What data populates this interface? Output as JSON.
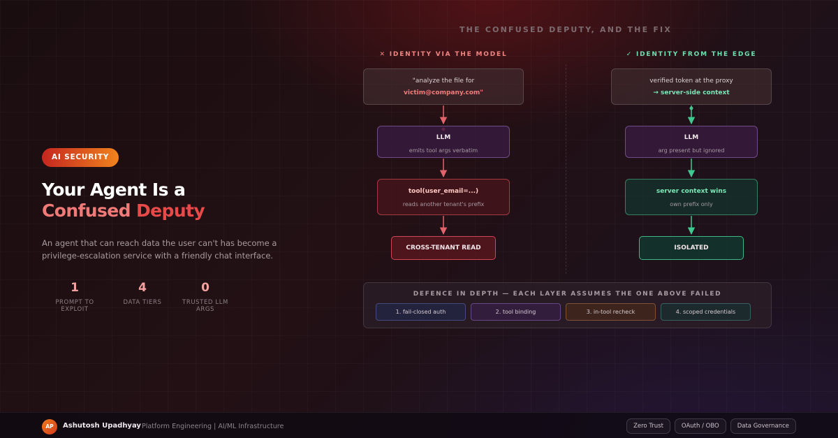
{
  "left": {
    "badge": "AI SECURITY",
    "headline_line1": "Your Agent Is a",
    "headline_line2a": "Confused ",
    "headline_line2b": "Deputy",
    "description": "An agent that can reach data the user can't has become a privilege-escalation service with a friendly chat interface.",
    "stats": [
      {
        "value": "1",
        "label": "PROMPT TO EXPLOIT"
      },
      {
        "value": "4",
        "label": "DATA TIERS"
      },
      {
        "value": "0",
        "label": "TRUSTED LLM ARGS"
      }
    ]
  },
  "diagram": {
    "title": "THE CONFUSED DEPUTY, AND THE FIX",
    "left_column": {
      "title": "✕ IDENTITY VIA THE MODEL",
      "quote_line1": "\"analyze the file for",
      "quote_line2": "victim@company.com\"",
      "llm_title": "LLM",
      "llm_sub": "emits tool args verbatim",
      "tool_title": "tool(user_email=...)",
      "tool_sub": "reads another tenant's prefix",
      "result": "CROSS-TENANT READ"
    },
    "right_column": {
      "title": "✓ IDENTITY FROM THE EDGE",
      "quote_line1": "verified token at the proxy",
      "quote_line2": "→ server-side context",
      "llm_title": "LLM",
      "llm_sub": "arg present but ignored",
      "server_title": "server context wins",
      "server_sub": "own prefix only",
      "result": "ISOLATED"
    },
    "defence": {
      "title": "DEFENCE IN DEPTH — EACH LAYER ASSUMES THE ONE ABOVE FAILED",
      "layers": [
        "1. fail-closed auth",
        "2. tool binding",
        "3. in-tool recheck",
        "4. scoped credentials"
      ]
    },
    "colors": {
      "bad_arrow": "#e0646c",
      "good_arrow": "#3fc890"
    }
  },
  "footer": {
    "avatar_initials": "AP",
    "name": "Ashutosh Upadhyay",
    "role": "Platform Engineering | AI/ML Infrastructure",
    "tags": [
      "Zero Trust",
      "OAuth / OBO",
      "Data Governance"
    ]
  }
}
